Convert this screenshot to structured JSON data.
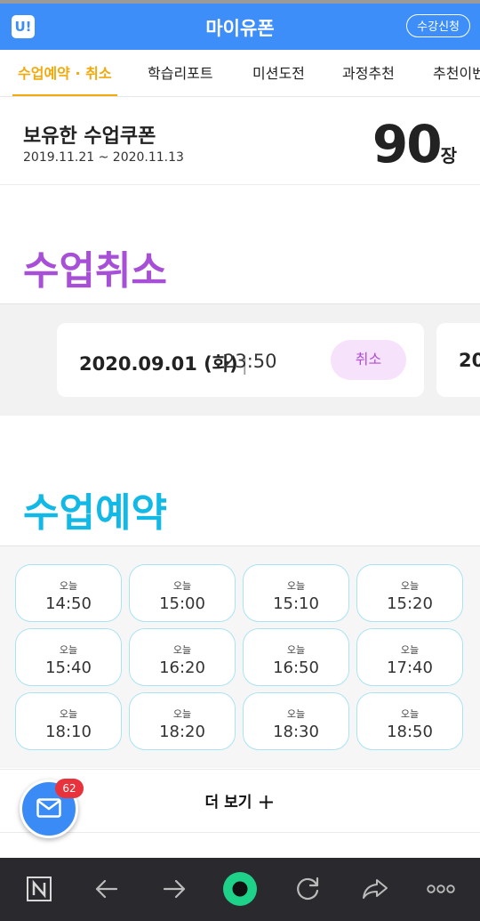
{
  "header": {
    "logo_text": "U!",
    "title": "마이유폰",
    "enroll_label": "수강신청"
  },
  "tabs": [
    {
      "label": "수업예약 · 취소",
      "active": true
    },
    {
      "label": "학습리포트",
      "active": false
    },
    {
      "label": "미션도전",
      "active": false
    },
    {
      "label": "과정추천",
      "active": false
    },
    {
      "label": "추천이벤",
      "active": false
    }
  ],
  "coupon": {
    "title": "보유한 수업쿠폰",
    "period": "2019.11.21 ~ 2020.11.13",
    "count": "90",
    "unit": "장"
  },
  "cancel_section": {
    "heading": "수업취소",
    "cards": [
      {
        "date": "2020.09.01 (화)",
        "separator": "|",
        "time": "23:50",
        "cancel_label": "취소"
      },
      {
        "date": "20",
        "separator": "",
        "time": "",
        "cancel_label": ""
      }
    ]
  },
  "reserve_section": {
    "heading": "수업예약",
    "slots": [
      {
        "day": "오늘",
        "time": "14:50"
      },
      {
        "day": "오늘",
        "time": "15:00"
      },
      {
        "day": "오늘",
        "time": "15:10"
      },
      {
        "day": "오늘",
        "time": "15:20"
      },
      {
        "day": "오늘",
        "time": "15:40"
      },
      {
        "day": "오늘",
        "time": "16:20"
      },
      {
        "day": "오늘",
        "time": "16:50"
      },
      {
        "day": "오늘",
        "time": "17:40"
      },
      {
        "day": "오늘",
        "time": "18:10"
      },
      {
        "day": "오늘",
        "time": "18:20"
      },
      {
        "day": "오늘",
        "time": "18:30"
      },
      {
        "day": "오늘",
        "time": "18:50"
      }
    ],
    "more_label": "더 보기",
    "more_icon": "plus-icon"
  },
  "mail_fab": {
    "icon": "mail-icon",
    "badge": "62"
  },
  "bottom_nav": {
    "items": [
      "naver-home-icon",
      "back-arrow-icon",
      "forward-arrow-icon",
      "green-dot-icon",
      "refresh-icon",
      "share-icon",
      "more-dots-icon"
    ]
  },
  "colors": {
    "header_bg": "#3d8ef8",
    "tab_active": "#f2a90c",
    "cancel_heading": "#a84fd8",
    "cancel_button_bg": "#f7e2fc",
    "reserve_heading": "#12b8e6",
    "slot_border": "#a9e3f3",
    "badge": "#e8323c",
    "nav_bg": "#2a2a2e"
  }
}
